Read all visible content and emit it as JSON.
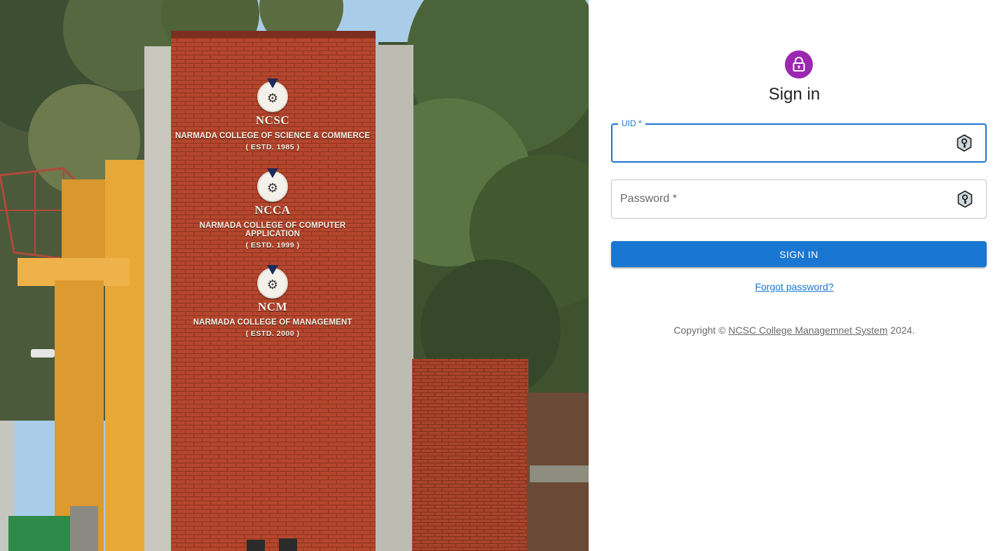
{
  "signage": [
    {
      "abbr": "NCSC",
      "name": "NARMADA COLLEGE OF SCIENCE & COMMERCE",
      "estd": "( ESTD. 1985 )"
    },
    {
      "abbr": "NCCA",
      "name": "NARMADA COLLEGE OF COMPUTER APPLICATION",
      "estd": "( ESTD. 1999 )"
    },
    {
      "abbr": "NCM",
      "name": "NARMADA COLLEGE OF MANAGEMENT",
      "estd": "( ESTD. 2000 )"
    }
  ],
  "form": {
    "avatar_icon": "lock-icon",
    "title": "Sign in",
    "uid": {
      "label": "UID *",
      "value": "",
      "icon": "key-icon"
    },
    "password": {
      "placeholder": "Password *",
      "value": "",
      "icon": "key-icon"
    },
    "submit_label": "SIGN IN",
    "forgot_label": "Forgot password?"
  },
  "footer": {
    "prefix": "Copyright © ",
    "link_text": "NCSC College Managemnet System",
    "suffix": " 2024."
  },
  "colors": {
    "primary": "#1976d2",
    "avatar": "#9c27b0",
    "brick": "#b5462d"
  }
}
